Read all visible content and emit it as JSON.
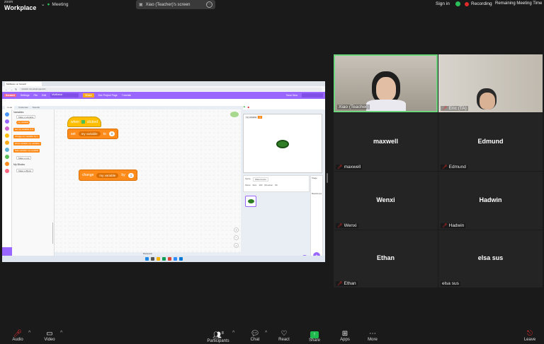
{
  "topbar": {
    "brand_small": "zoom",
    "brand_big": "Workplace",
    "meeting_label": "Meeting",
    "shared_screen_label": "Xiao (Teacher)'s screen",
    "sign_in": "Sign in",
    "recording": "Recording",
    "remaining": "Remaining Meeting Time"
  },
  "scratch": {
    "browser_tab": "MidMelon on Scratch",
    "url": "scratch.mit.edu/projects/1",
    "menu": {
      "settings": "Settings",
      "file": "File",
      "edit": "Edit",
      "project_title": "MidMelon",
      "share": "Share",
      "see_page": "See Project Page",
      "tutorials": "Tutorials",
      "save_now": "Save Now"
    },
    "tabs": {
      "code": "Code",
      "costumes": "Costumes",
      "sounds": "Sounds"
    },
    "palette": {
      "variables_heading": "Variables",
      "make_variable": "Make a Variable",
      "my_variable": "my variable",
      "set_block": "set my variable to 0",
      "change_block": "change my variable by 1",
      "show_block": "show variable my variable",
      "hide_block": "hide variable my variable",
      "make_list": "Make a List",
      "my_blocks": "My Blocks",
      "make_block": "Make a Block"
    },
    "workspace": {
      "when_label": "when",
      "clicked_label": "clicked",
      "set_label": "set",
      "set_var": "my variable",
      "to_label": "to",
      "set_value": "0",
      "change_label": "change",
      "change_var": "my variable",
      "by_label": "by",
      "change_value": "1",
      "backpack": "Backpack"
    },
    "stage": {
      "variable_monitor_label": "my variable",
      "variable_monitor_value": "0",
      "sprite_name": "Watermelon",
      "stage_label": "Stage",
      "backdrops_label": "Backdrops",
      "sprite_field_label": "Sprite",
      "show_label": "Show",
      "size_label": "Size",
      "direction_label": "Direction",
      "size_value": "100",
      "direction_value": "90"
    }
  },
  "participants": [
    {
      "name": "Xiao (Teacher)",
      "video": true,
      "muted": false
    },
    {
      "name": "Eric (TA)",
      "video": true,
      "muted": true
    },
    {
      "display": "maxwell",
      "name": "maxwell",
      "muted": true
    },
    {
      "display": "Edmund",
      "name": "Edmund",
      "muted": true
    },
    {
      "display": "Wenxi",
      "name": "Wenxi",
      "muted": true
    },
    {
      "display": "Hadwin",
      "name": "Hadwin",
      "muted": true
    },
    {
      "display": "Ethan",
      "name": "Ethan",
      "muted": true
    },
    {
      "display": "elsa sus",
      "name": "elsa sus",
      "muted": false
    }
  ],
  "toolbar": {
    "audio": "Audio",
    "video": "Video",
    "participants": "Participants",
    "participants_count": "8",
    "chat": "Chat",
    "react": "React",
    "share": "Share",
    "apps": "Apps",
    "more": "More",
    "leave": "Leave"
  },
  "colors": {
    "scratch_purple": "#9966ff",
    "variables_orange": "#ff8c1a",
    "events_yellow": "#ffbf00",
    "recording_red": "#e02b2b",
    "share_green": "#1fb84f",
    "active_speaker_border": "#6fd680"
  }
}
